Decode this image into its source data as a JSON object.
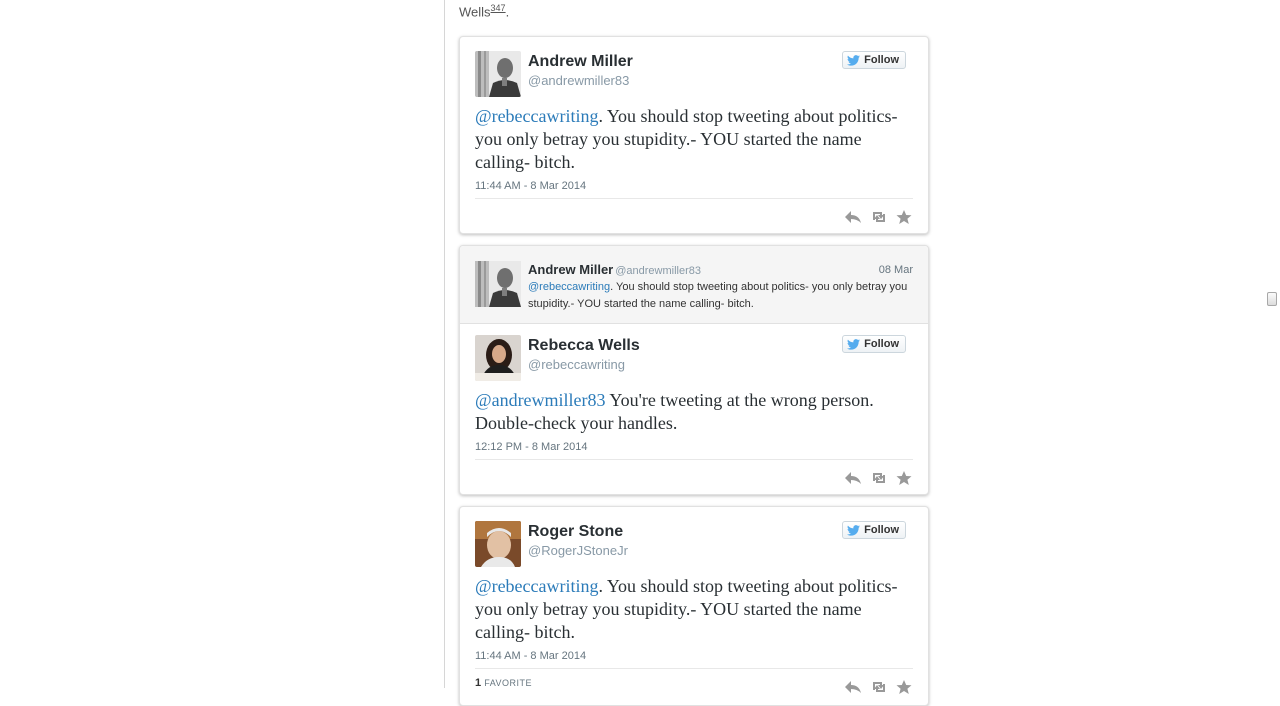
{
  "intro": {
    "text": "Wells",
    "footnote": "347",
    "after": "."
  },
  "tweets": [
    {
      "name": "Andrew Miller",
      "handle": "@andrewmiller83",
      "follow_label": "Follow",
      "mention": "@rebeccawriting",
      "text": ". You should stop tweeting about politics- you only betray you stupidity.- YOU started the name calling- bitch.",
      "date": "11:44 AM - 8 Mar 2014"
    },
    {
      "quoted": {
        "name": "Andrew Miller",
        "handle": "@andrewmiller83",
        "date": "08 Mar",
        "mention": "@rebeccawriting",
        "text": ". You should stop tweeting about politics- you only betray you stupidity.- YOU started the name calling- bitch."
      },
      "name": "Rebecca Wells",
      "handle": "@rebeccawriting",
      "follow_label": "Follow",
      "mention": "@andrewmiller83",
      "text": " You're tweeting at the wrong person. Double-check your handles.",
      "date": "12:12 PM - 8 Mar 2014"
    },
    {
      "name": "Roger Stone",
      "handle": "@RogerJStoneJr",
      "follow_label": "Follow",
      "mention": "@rebeccawriting",
      "text": ". You should stop tweeting about politics- you only betray you stupidity.- YOU started the name calling- bitch.",
      "date": "11:44 AM - 8 Mar 2014",
      "favorites_count": "1",
      "favorites_label": "FAVORITE"
    }
  ],
  "icons": {
    "reply": "reply-icon",
    "retweet": "retweet-icon",
    "favorite": "star-icon",
    "twitter_bird": "twitter-bird-icon"
  },
  "colors": {
    "mention": "#2b7bb9",
    "bird": "#55acee",
    "action_icon": "#999999"
  }
}
